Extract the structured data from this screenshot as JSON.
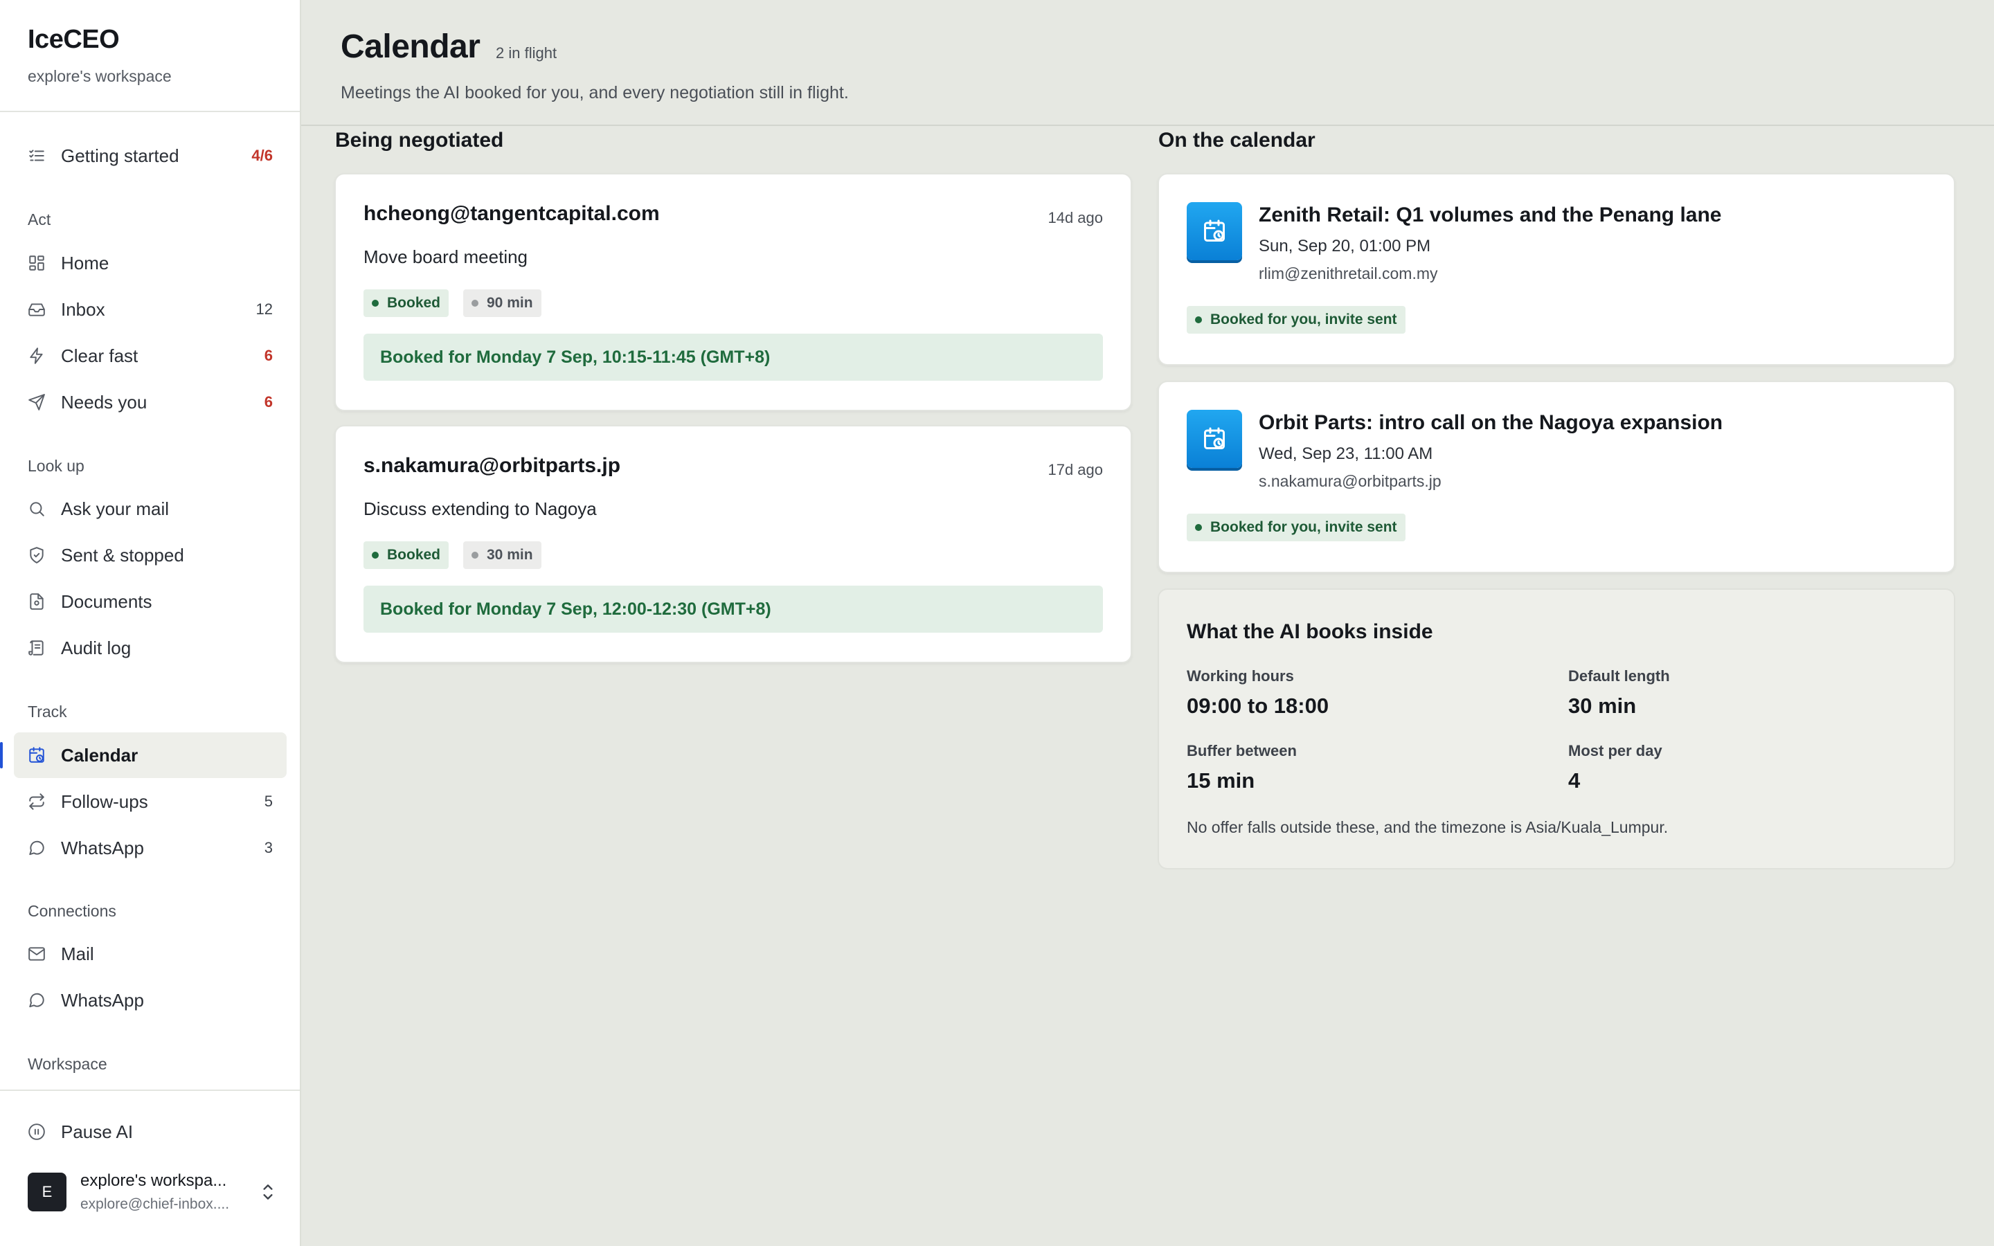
{
  "app": {
    "name": "IceCEO",
    "workspace": "explore's workspace"
  },
  "sidebar": {
    "getting_started": {
      "label": "Getting started",
      "count": "4/6"
    },
    "sections": {
      "act": "Act",
      "look_up": "Look up",
      "track": "Track",
      "connections": "Connections",
      "workspace": "Workspace"
    },
    "act_items": [
      {
        "label": "Home",
        "count": ""
      },
      {
        "label": "Inbox",
        "count": "12"
      },
      {
        "label": "Clear fast",
        "count": "6"
      },
      {
        "label": "Needs you",
        "count": "6"
      }
    ],
    "lookup_items": [
      {
        "label": "Ask your mail"
      },
      {
        "label": "Sent & stopped"
      },
      {
        "label": "Documents"
      },
      {
        "label": "Audit log"
      }
    ],
    "track_items": [
      {
        "label": "Calendar",
        "count": ""
      },
      {
        "label": "Follow-ups",
        "count": "5"
      },
      {
        "label": "WhatsApp",
        "count": "3"
      }
    ],
    "connection_items": [
      {
        "label": "Mail"
      },
      {
        "label": "WhatsApp"
      }
    ],
    "pause_ai": "Pause AI",
    "user": {
      "initial": "E",
      "name": "explore's workspa...",
      "email": "explore@chief-inbox...."
    }
  },
  "page": {
    "title": "Calendar",
    "badge": "2 in flight",
    "description": "Meetings the AI booked for you, and every negotiation still in flight."
  },
  "negotiated": {
    "heading": "Being negotiated",
    "items": [
      {
        "email": "hcheong@tangentcapital.com",
        "ago": "14d ago",
        "subject": "Move board meeting",
        "status": "Booked",
        "duration": "90 min",
        "booked_text": "Booked for Monday 7 Sep, 10:15-11:45 (GMT+8)"
      },
      {
        "email": "s.nakamura@orbitparts.jp",
        "ago": "17d ago",
        "subject": "Discuss extending to Nagoya",
        "status": "Booked",
        "duration": "30 min",
        "booked_text": "Booked for Monday 7 Sep, 12:00-12:30 (GMT+8)"
      }
    ]
  },
  "calendar": {
    "heading": "On the calendar",
    "events": [
      {
        "title": "Zenith Retail: Q1 volumes and the Penang lane",
        "time": "Sun, Sep 20, 01:00 PM",
        "email": "rlim@zenithretail.com.my",
        "status": "Booked for you, invite sent"
      },
      {
        "title": "Orbit Parts: intro call on the Nagoya expansion",
        "time": "Wed, Sep 23, 11:00 AM",
        "email": "s.nakamura@orbitparts.jp",
        "status": "Booked for you, invite sent"
      }
    ]
  },
  "rules": {
    "title": "What the AI books inside",
    "working_hours": {
      "label": "Working hours",
      "value": "09:00 to 18:00"
    },
    "default_length": {
      "label": "Default length",
      "value": "30 min"
    },
    "buffer": {
      "label": "Buffer between",
      "value": "15 min"
    },
    "most_per_day": {
      "label": "Most per day",
      "value": "4"
    },
    "note": "No offer falls outside these, and the timezone is Asia/Kuala_Lumpur."
  },
  "colors": {
    "accent": "#2152d6",
    "alert": "#c2352a",
    "success": "#1f6b3d",
    "calendar_icon": "#0a80d6"
  }
}
